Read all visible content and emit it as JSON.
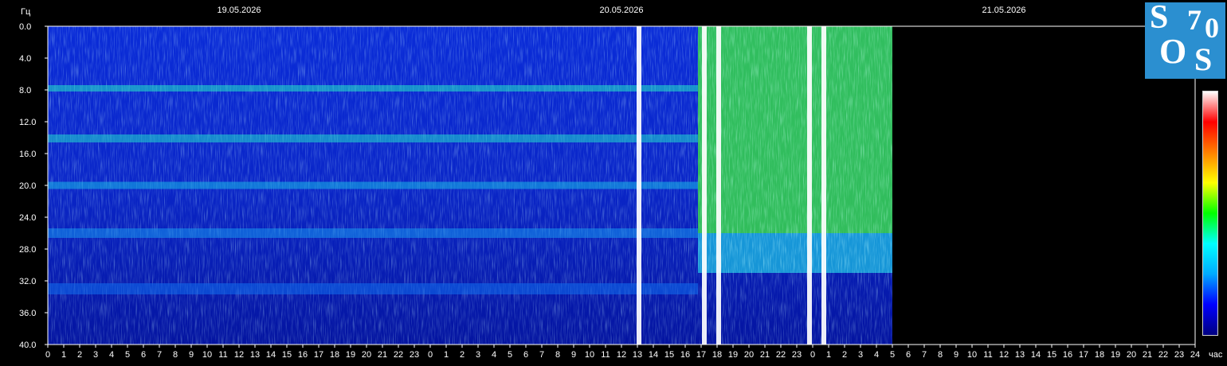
{
  "chart_data": {
    "type": "heatmap",
    "ylabel": "Гц",
    "xlabel_unit": "час",
    "dates": [
      "19.05.2026",
      "20.05.2026",
      "21.05.2026"
    ],
    "y_ticks": [
      "0.0",
      "4.0",
      "8.0",
      "12.0",
      "16.0",
      "20.0",
      "24.0",
      "28.0",
      "32.0",
      "36.0",
      "40.0"
    ],
    "x_ticks": [
      "0",
      "1",
      "2",
      "3",
      "4",
      "5",
      "6",
      "7",
      "8",
      "9",
      "10",
      "11",
      "12",
      "13",
      "14",
      "15",
      "16",
      "17",
      "18",
      "19",
      "20",
      "21",
      "22",
      "23",
      "0",
      "1",
      "2",
      "3",
      "4",
      "5",
      "6",
      "7",
      "8",
      "9",
      "10",
      "11",
      "12",
      "13",
      "14",
      "15",
      "16",
      "17",
      "18",
      "19",
      "20",
      "21",
      "22",
      "23",
      "0",
      "1",
      "2",
      "3",
      "4",
      "5",
      "6",
      "7",
      "8",
      "9",
      "10",
      "11",
      "12",
      "13",
      "14",
      "15",
      "16",
      "17",
      "18",
      "19",
      "20",
      "21",
      "22",
      "23",
      "24"
    ],
    "ylim": [
      0,
      40
    ],
    "xlim_hours": [
      0,
      72
    ],
    "data_coverage_hours": [
      0,
      53
    ],
    "resonance_bands_hz": [
      7.8,
      14.1,
      20.0,
      26.0,
      33.0
    ],
    "intense_activity_hours": [
      [
        40.8,
        53
      ]
    ],
    "saturated_spikes_hours": [
      37.1,
      41.2,
      42.1,
      47.8,
      48.7
    ],
    "colorscale": [
      "#000080",
      "#0000ff",
      "#00aaff",
      "#00ffff",
      "#00ff00",
      "#ffff00",
      "#ff8000",
      "#ff0000",
      "#ffffff"
    ]
  },
  "logo": {
    "letters": [
      "S",
      "7",
      "0",
      "O",
      "S"
    ]
  }
}
